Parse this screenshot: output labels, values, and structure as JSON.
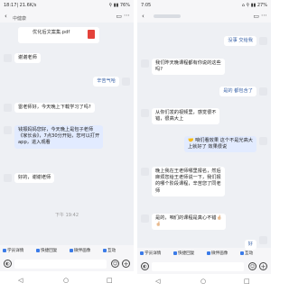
{
  "left": {
    "status": {
      "time": "18:17| 21.6K/s",
      "icons": "⚲ ▮▮ 76%"
    },
    "header": {
      "subtitle": "中健康"
    },
    "file": {
      "name": "优化后文案集.pdf"
    },
    "messages": [
      {
        "text": "谢谢老师"
      },
      {
        "text": "辛苦气哈"
      },
      {
        "text": "雷老师好，今天晚上下载学习了吗?"
      },
      {
        "lines": [
          "钱振妈妈您好，今天晚上是包子老师",
          "《家长会》，7点30分开始，您可以打开",
          "app，进入观看"
        ]
      },
      {
        "text": "好的，谢谢老师"
      }
    ],
    "timestamp": "下午 19:42",
    "toolbar": [
      "学员详情",
      "快捷回复",
      "微伴画像",
      "互动"
    ],
    "nav": [
      "◁",
      "○",
      "□"
    ]
  },
  "right": {
    "status": {
      "time": "7:05",
      "icons": "⌂ ⚲ ▮▮ 27%"
    },
    "messages": [
      {
        "text": "没事 交给我"
      },
      {
        "lines": [
          "我们昨天晚课程都有你说的这些",
          "吗?"
        ]
      },
      {
        "text": "是的 都包含了"
      },
      {
        "lines": [
          "从你们发的视频里，感觉很不",
          "错，很高大上"
        ]
      },
      {
        "lines": [
          "🤝 咱们看效果 这个不是光高大",
          "上就好了 效果很说"
        ]
      },
      {
        "lines": [
          "晚上我在王老师哪里报名，然后",
          "麻烦您给王老师说一下，我们报",
          "的哪个阶段课程，辛苦您了同老",
          "师"
        ]
      },
      {
        "lines": [
          "是的，咱们的课程是真心不错🤞🏻",
          "🤞🏻"
        ]
      },
      {
        "text": "好"
      }
    ],
    "toolbar": [
      "学员详情",
      "快捷回复",
      "微伴画像",
      "互动"
    ],
    "nav": [
      "◁",
      "○",
      "□"
    ]
  }
}
